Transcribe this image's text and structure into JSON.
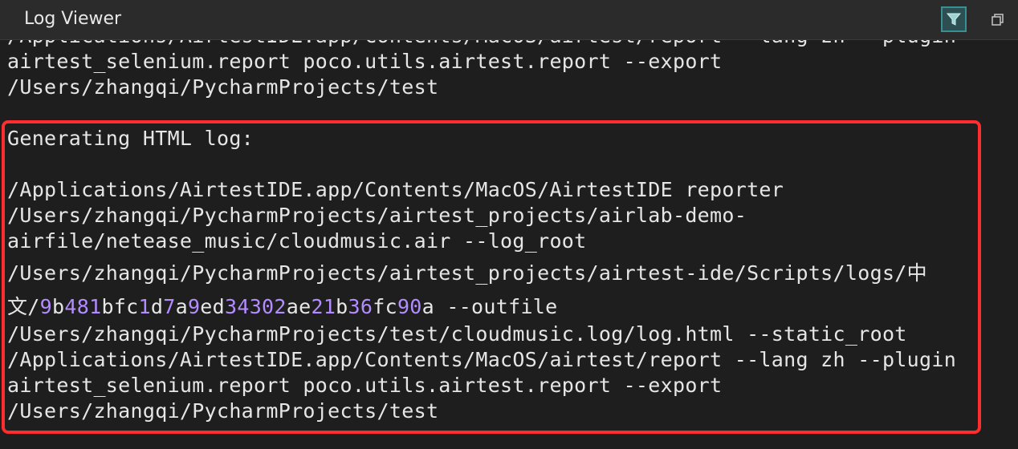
{
  "window": {
    "title": "Log Viewer",
    "filter_icon": "filter-funnel-icon",
    "restore_icon": "restore-window-icon",
    "accent_color": "#3a8f94",
    "highlight_color": "#ff2d2d",
    "number_color": "#b38cff"
  },
  "log": {
    "lines": [
      "/Applications/AirtestIDE.app/Contents/MacOS/airtest/report --lang zh --plugin",
      "airtest_selenium.report poco.utils.airtest.report --export",
      "/Users/zhangqi/PycharmProjects/test",
      "Generating HTML log:",
      "/Applications/AirtestIDE.app/Contents/MacOS/AirtestIDE reporter",
      "/Users/zhangqi/PycharmProjects/airtest_projects/airlab-demo-",
      "airfile/netease_music/cloudmusic.air --log_root",
      "/Users/zhangqi/PycharmProjects/airtest_projects/airtest-ide/Scripts/logs/中",
      "文/9b481bfc1d7a9ed34302ae21b36fc90a --outfile",
      "/Users/zhangqi/PycharmProjects/test/cloudmusic.log/log.html --static_root",
      "/Applications/AirtestIDE.app/Contents/MacOS/airtest/report --lang zh --plugin",
      "airtest_selenium.report poco.utils.airtest.report --export",
      "/Users/zhangqi/PycharmProjects/test"
    ]
  }
}
